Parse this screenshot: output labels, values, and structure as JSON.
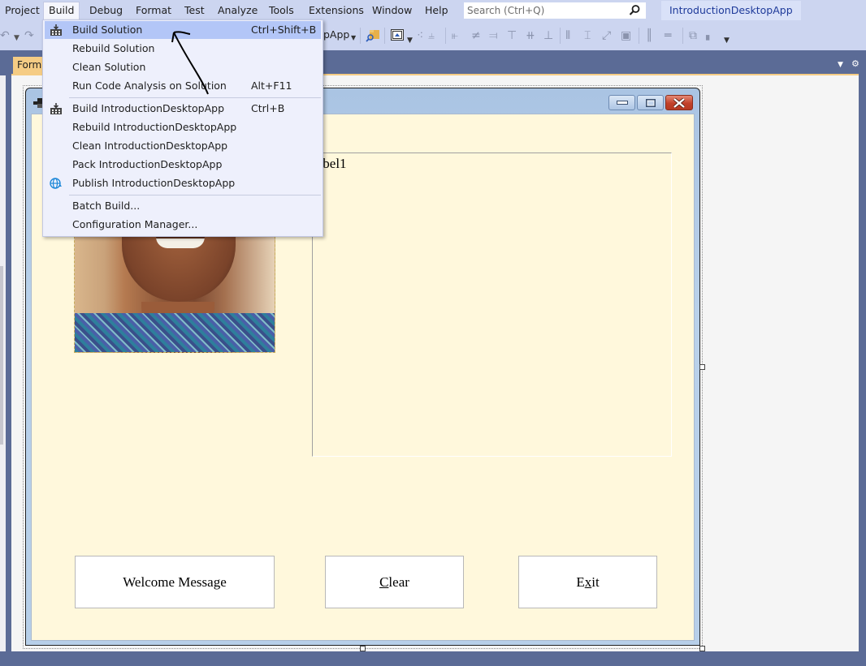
{
  "menubar": {
    "items": [
      {
        "label": "Project"
      },
      {
        "label": "Build",
        "open": true
      },
      {
        "label": "Debug"
      },
      {
        "label": "Format"
      },
      {
        "label": "Test"
      },
      {
        "label": "Analyze"
      },
      {
        "label": "Tools"
      },
      {
        "label": "Extensions"
      },
      {
        "label": "Window"
      },
      {
        "label": "Help"
      }
    ],
    "search_placeholder": "Search (Ctrl+Q)",
    "solution_name": "IntroductionDesktopApp"
  },
  "toolbar": {
    "startup_project_fragment": "pApp"
  },
  "document_tab": {
    "label": "Form1"
  },
  "build_menu": {
    "items": [
      {
        "label": "Build Solution",
        "shortcut": "Ctrl+Shift+B",
        "icon": "build-icon",
        "highlighted": true
      },
      {
        "label": "Rebuild Solution",
        "shortcut": ""
      },
      {
        "label": "Clean Solution",
        "shortcut": ""
      },
      {
        "label": "Run Code Analysis on Solution",
        "shortcut": "Alt+F11"
      },
      {
        "label": "Build IntroductionDesktopApp",
        "shortcut": "Ctrl+B",
        "icon": "build-icon"
      },
      {
        "label": "Rebuild IntroductionDesktopApp",
        "shortcut": ""
      },
      {
        "label": "Clean IntroductionDesktopApp",
        "shortcut": ""
      },
      {
        "label": "Pack IntroductionDesktopApp",
        "shortcut": ""
      },
      {
        "label": "Publish IntroductionDesktopApp",
        "shortcut": "",
        "icon": "publish-globe-icon"
      },
      {
        "label": "Batch Build...",
        "shortcut": ""
      },
      {
        "label": "Configuration Manager...",
        "shortcut": ""
      }
    ]
  },
  "form": {
    "label_text": "label1",
    "buttons": [
      {
        "label": "Welcome Message",
        "mnemonic": ""
      },
      {
        "label_pre": "",
        "mnemonic": "C",
        "label_post": "lear"
      },
      {
        "label_pre": "E",
        "mnemonic": "x",
        "label_post": "it"
      }
    ]
  },
  "colors": {
    "menubar_bg": "#ccd5f0",
    "highlight": "#b3c6f7",
    "form_client_bg": "#fff8dc",
    "tab_accent": "#f5cc84",
    "close_button": "#c2412a"
  }
}
